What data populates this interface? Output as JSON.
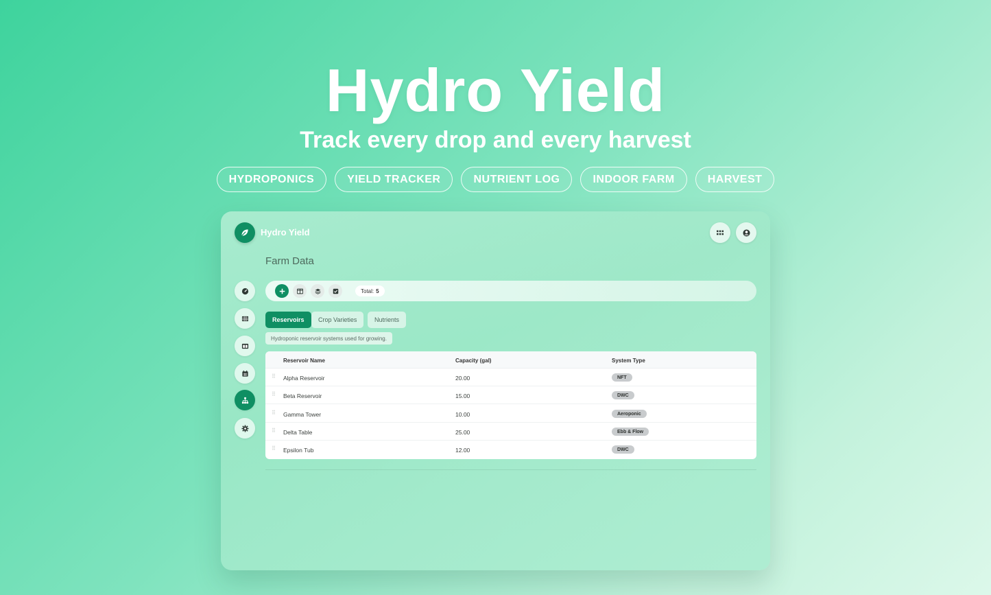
{
  "hero": {
    "title": "Hydro Yield",
    "subtitle": "Track every drop and every harvest",
    "tags": [
      "HYDROPONICS",
      "YIELD TRACKER",
      "NUTRIENT LOG",
      "INDOOR FARM",
      "HARVEST"
    ]
  },
  "app": {
    "name": "Hydro Yield",
    "logo_icon": "leaf-icon",
    "top_buttons": [
      "apps-grid-icon",
      "user-circle-icon"
    ],
    "page_title": "Farm Data",
    "accent_color": "#0f8f63"
  },
  "sidebar": {
    "items": [
      {
        "icon": "dashboard-gauge-icon",
        "active": false
      },
      {
        "icon": "table-icon",
        "active": false
      },
      {
        "icon": "columns-icon",
        "active": false
      },
      {
        "icon": "calendar-icon",
        "active": false
      },
      {
        "icon": "hierarchy-icon",
        "active": true
      },
      {
        "icon": "gear-icon",
        "active": false
      }
    ]
  },
  "toolbar": {
    "buttons": [
      "add-icon",
      "columns-icon",
      "layers-icon",
      "checkbox-icon"
    ],
    "total_label": "Total:",
    "total_value": "5"
  },
  "tabs": [
    {
      "label": "Reservoirs",
      "active": true
    },
    {
      "label": "Crop Varieties",
      "active": false
    },
    {
      "label": "Nutrients",
      "active": false
    }
  ],
  "tab_description": "Hydroponic reservoir systems used for growing.",
  "table": {
    "columns": [
      "Reservoir Name",
      "Capacity (gal)",
      "System Type"
    ],
    "rows": [
      {
        "name": "Alpha Reservoir",
        "capacity": "20.00",
        "type": "NFT"
      },
      {
        "name": "Beta Reservoir",
        "capacity": "15.00",
        "type": "DWC"
      },
      {
        "name": "Gamma Tower",
        "capacity": "10.00",
        "type": "Aeroponic"
      },
      {
        "name": "Delta Table",
        "capacity": "25.00",
        "type": "Ebb & Flow"
      },
      {
        "name": "Epsilon Tub",
        "capacity": "12.00",
        "type": "DWC"
      }
    ]
  }
}
